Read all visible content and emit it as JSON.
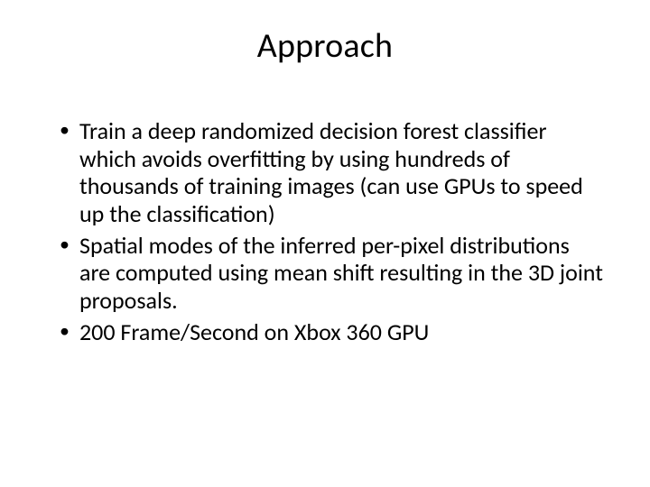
{
  "slide": {
    "title": "Approach",
    "bullets": [
      "Train a deep randomized decision forest classifier which avoids overfitting by using hundreds of thousands of training images (can use GPUs to speed up the classification)",
      "Spatial modes of the inferred per-pixel distributions are computed using mean shift resulting in the 3D joint proposals.",
      "200 Frame/Second on Xbox 360 GPU"
    ]
  }
}
